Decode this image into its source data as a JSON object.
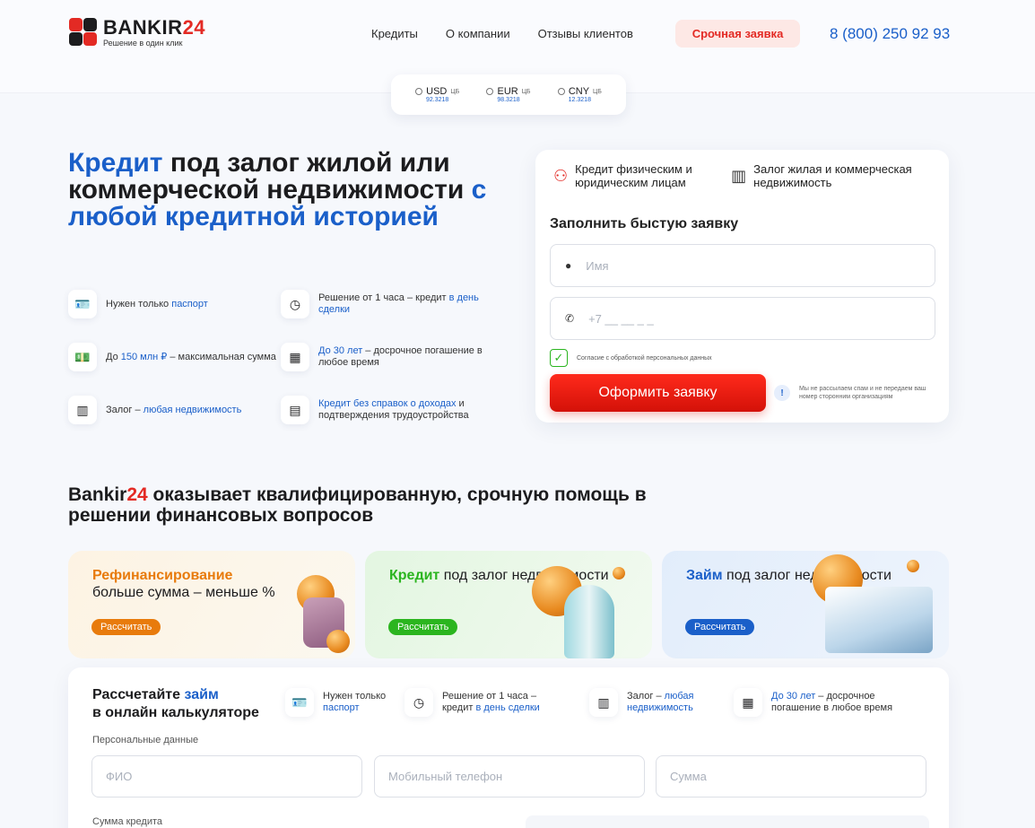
{
  "brand": {
    "name_a": "BANKIR",
    "name_b": "24",
    "tagline": "Решение в один клик"
  },
  "nav": {
    "items": [
      "Кредиты",
      "О компании",
      "Отзывы клиентов"
    ]
  },
  "header": {
    "urgent_label": "Срочная заявка",
    "phone": "8 (800) 250 92 93"
  },
  "rates": [
    {
      "code": "USD",
      "tag": "ЦБ",
      "value": "92.3218"
    },
    {
      "code": "EUR",
      "tag": "ЦБ",
      "value": "98.3218"
    },
    {
      "code": "CNY",
      "tag": "ЦБ",
      "value": "12.3218"
    }
  ],
  "hero": {
    "t1": "Кредит",
    "t2": " под залог жилой или коммерческой недвижимости ",
    "t3": "с любой кредитной историей"
  },
  "features": [
    {
      "icon": "passport-icon",
      "a": "Нужен только ",
      "b": "паспорт",
      "c": ""
    },
    {
      "icon": "clock-icon",
      "a": "Решение от 1 часа – кредит ",
      "b": "в день сделки",
      "c": ""
    },
    {
      "icon": "money-icon",
      "a": "До ",
      "b": "150 млн ₽",
      "c": " – максимальная сумма"
    },
    {
      "icon": "calendar-icon",
      "a": "",
      "b": "До 30 лет",
      "c": " – досрочное погашение в любое время"
    },
    {
      "icon": "building-icon",
      "a": "Залог – ",
      "b": "любая недвижимость",
      "c": ""
    },
    {
      "icon": "document-icon",
      "a": "",
      "b": "Кредит без справок о доходах",
      "c": " и подтверждения трудоустройства"
    }
  ],
  "form": {
    "tab1": "Кредит физическим и юридическим лицам",
    "tab2": "Залог жилая и коммерческая недвижимость",
    "heading": "Заполнить быстую заявку",
    "name_placeholder": "Имя",
    "phone_placeholder": "+7 __ __ _ _",
    "consent": "Согласие с обработкой персональных данных",
    "submit": "Оформить заявку",
    "note": "Мы не рассылаем спам и не передаем ваш номер сторонним организациям"
  },
  "section2": {
    "brand_a": "Bankir",
    "brand_b": "24",
    "text": " оказывает квалифицированную, срочную помощь в решении финансовых вопросов"
  },
  "cards": [
    {
      "accent": "Рефинансирование",
      "rest": "больше сумма – меньше %",
      "button": "Рассчитать",
      "color": "#e87b0c"
    },
    {
      "accent": "Кредит",
      "rest": " под залог недвижимости",
      "button": "Рассчитать",
      "color": "#2bb51f"
    },
    {
      "accent": "Займ",
      "rest": " под залог недвижимости",
      "button": "Рассчитать",
      "color": "#1a5fc9"
    }
  ],
  "calc": {
    "title_a": "Рассчетайте ",
    "title_b": "займ",
    "title_c": "в онлайн калькуляторе",
    "features": [
      {
        "a": "Нужен только",
        "b": "паспорт",
        "c": ""
      },
      {
        "a": "Решение от 1 часа –",
        "b": "в день сделки",
        "c": "кредит "
      },
      {
        "a": "Залог – ",
        "b": "любая недвижимость",
        "c": ""
      },
      {
        "a": "",
        "b": "До 30 лет",
        "c": " – досрочное погашение в любое время"
      }
    ],
    "personal_label": "Персональные данные",
    "fio": "ФИО",
    "mobile": "Мобильный телефон",
    "sum": "Сумма",
    "amount_label": "Сумма кредита"
  }
}
